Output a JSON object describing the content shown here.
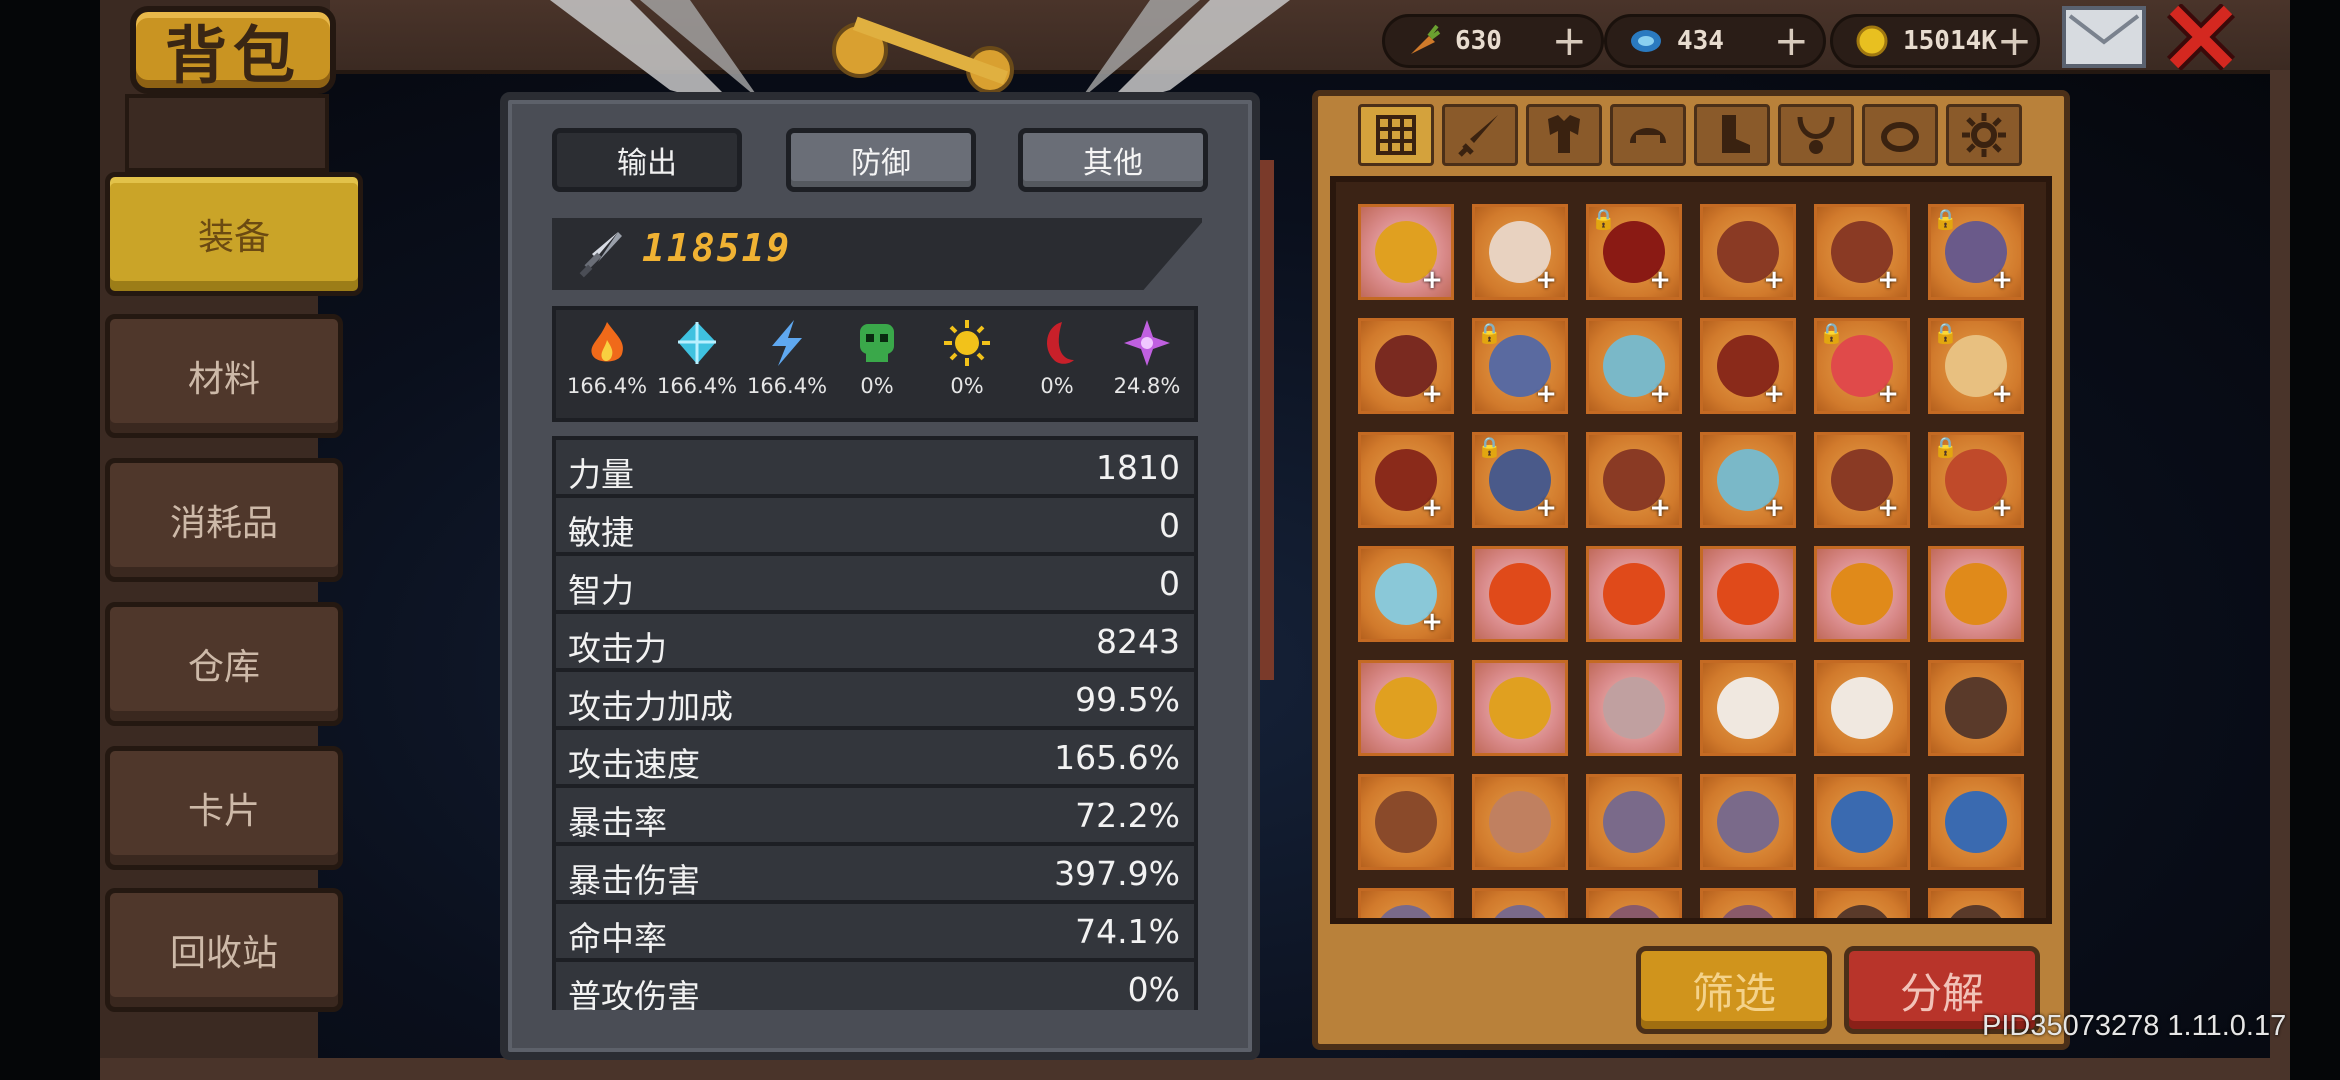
{
  "title": "背包",
  "side_tabs": [
    {
      "label": "装备",
      "active": true
    },
    {
      "label": "材料",
      "active": false
    },
    {
      "label": "消耗品",
      "active": false
    },
    {
      "label": "仓库",
      "active": false
    },
    {
      "label": "卡片",
      "active": false
    },
    {
      "label": "回收站",
      "active": false
    }
  ],
  "currency": [
    {
      "icon": "carrot-icon",
      "value": "630"
    },
    {
      "icon": "gem-icon",
      "value": "434"
    },
    {
      "icon": "gold-coin-icon",
      "value": "15014K"
    }
  ],
  "currency_plus": "+",
  "stats_panel": {
    "tabs": [
      {
        "label": "输出",
        "active": true
      },
      {
        "label": "防御",
        "active": false
      },
      {
        "label": "其他",
        "active": false
      }
    ],
    "power": "118519",
    "elements": [
      {
        "icon": "fire-icon",
        "color": "#f06a1a",
        "value": "166.4%"
      },
      {
        "icon": "ice-crystal-icon",
        "color": "#3fc2e0",
        "value": "166.4%"
      },
      {
        "icon": "lightning-icon",
        "color": "#5fa8f0",
        "value": "166.4%"
      },
      {
        "icon": "poison-skull-icon",
        "color": "#3aa84a",
        "value": "0%"
      },
      {
        "icon": "light-sun-icon",
        "color": "#f2c21a",
        "value": "0%"
      },
      {
        "icon": "dark-moon-icon",
        "color": "#c8202a",
        "value": "0%"
      },
      {
        "icon": "arcane-star-icon",
        "color": "#c060e0",
        "value": "24.8%"
      }
    ],
    "rows": [
      {
        "label": "力量",
        "value": "1810"
      },
      {
        "label": "敏捷",
        "value": "0"
      },
      {
        "label": "智力",
        "value": "0"
      },
      {
        "label": "攻击力",
        "value": "8243"
      },
      {
        "label": "攻击力加成",
        "value": "99.5%"
      },
      {
        "label": "攻击速度",
        "value": "165.6%"
      },
      {
        "label": "暴击率",
        "value": "72.2%"
      },
      {
        "label": "暴击伤害",
        "value": "397.9%"
      },
      {
        "label": "命中率",
        "value": "74.1%"
      },
      {
        "label": "普攻伤害",
        "value": "0%"
      }
    ]
  },
  "inventory": {
    "categories": [
      "grid-all-icon",
      "sword-icon",
      "armor-icon",
      "helmet-icon",
      "boots-icon",
      "necklace-icon",
      "ring-icon",
      "gear-misc-icon"
    ],
    "slots": [
      {
        "color": "#e0a020",
        "pink": true,
        "plus": true,
        "lock": false
      },
      {
        "color": "#e8d2c0",
        "pink": false,
        "plus": true,
        "lock": false
      },
      {
        "color": "#8a1a14",
        "pink": false,
        "plus": true,
        "lock": true
      },
      {
        "color": "#8a3a24",
        "pink": false,
        "plus": true,
        "lock": false
      },
      {
        "color": "#8a3a24",
        "pink": false,
        "plus": true,
        "lock": false
      },
      {
        "color": "#6a5a8a",
        "pink": false,
        "plus": true,
        "lock": true
      },
      {
        "color": "#7a2a20",
        "pink": false,
        "plus": true,
        "lock": false
      },
      {
        "color": "#5a6aa0",
        "pink": false,
        "plus": true,
        "lock": true
      },
      {
        "color": "#7ab8c8",
        "pink": false,
        "plus": true,
        "lock": false
      },
      {
        "color": "#8a2a1a",
        "pink": false,
        "plus": true,
        "lock": false
      },
      {
        "color": "#e04a4a",
        "pink": false,
        "plus": true,
        "lock": true
      },
      {
        "color": "#e8c080",
        "pink": false,
        "plus": true,
        "lock": true
      },
      {
        "color": "#8a2a1a",
        "pink": false,
        "plus": true,
        "lock": false
      },
      {
        "color": "#4a5a8a",
        "pink": false,
        "plus": true,
        "lock": true
      },
      {
        "color": "#8a3a24",
        "pink": false,
        "plus": true,
        "lock": false
      },
      {
        "color": "#7ab8c8",
        "pink": false,
        "plus": true,
        "lock": false
      },
      {
        "color": "#8a3a24",
        "pink": false,
        "plus": true,
        "lock": false
      },
      {
        "color": "#c04a2a",
        "pink": false,
        "plus": true,
        "lock": true
      },
      {
        "color": "#8ac8d8",
        "pink": false,
        "plus": true,
        "lock": false
      },
      {
        "color": "#e04a1a",
        "pink": true,
        "plus": false,
        "lock": false
      },
      {
        "color": "#e04a1a",
        "pink": true,
        "plus": false,
        "lock": false
      },
      {
        "color": "#e04a1a",
        "pink": true,
        "plus": false,
        "lock": false
      },
      {
        "color": "#e08a1a",
        "pink": true,
        "plus": false,
        "lock": false
      },
      {
        "color": "#e08a1a",
        "pink": true,
        "plus": false,
        "lock": false
      },
      {
        "color": "#e0a020",
        "pink": true,
        "plus": false,
        "lock": false
      },
      {
        "color": "#e0a020",
        "pink": true,
        "plus": false,
        "lock": false
      },
      {
        "color": "#c0a0a0",
        "pink": true,
        "plus": false,
        "lock": false
      },
      {
        "color": "#f0e8e0",
        "pink": false,
        "plus": false,
        "lock": false
      },
      {
        "color": "#f0e8e0",
        "pink": false,
        "plus": false,
        "lock": false
      },
      {
        "color": "#5a3a2a",
        "pink": false,
        "plus": false,
        "lock": false
      },
      {
        "color": "#8a4a2a",
        "pink": false,
        "plus": false,
        "lock": false
      },
      {
        "color": "#c08060",
        "pink": false,
        "plus": false,
        "lock": false
      },
      {
        "color": "#7a6a8a",
        "pink": false,
        "plus": false,
        "lock": false
      },
      {
        "color": "#7a6a8a",
        "pink": false,
        "plus": false,
        "lock": false
      },
      {
        "color": "#3a6ab0",
        "pink": false,
        "plus": false,
        "lock": false
      },
      {
        "color": "#3a6ab0",
        "pink": false,
        "plus": false,
        "lock": false
      },
      {
        "color": "#7a6a8a",
        "pink": false,
        "plus": false,
        "lock": false
      },
      {
        "color": "#7a6a8a",
        "pink": false,
        "plus": false,
        "lock": false
      },
      {
        "color": "#8a5a6a",
        "pink": false,
        "plus": false,
        "lock": false
      },
      {
        "color": "#8a5a6a",
        "pink": false,
        "plus": false,
        "lock": false
      },
      {
        "color": "#5a3a2a",
        "pink": false,
        "plus": false,
        "lock": false
      },
      {
        "color": "#5a3a2a",
        "pink": false,
        "plus": false,
        "lock": false
      }
    ],
    "plus_mark": "+",
    "lock_mark": "🔒"
  },
  "buttons": {
    "filter": "筛选",
    "decompose": "分解"
  },
  "version": "PID35073278 1.11.0.17"
}
